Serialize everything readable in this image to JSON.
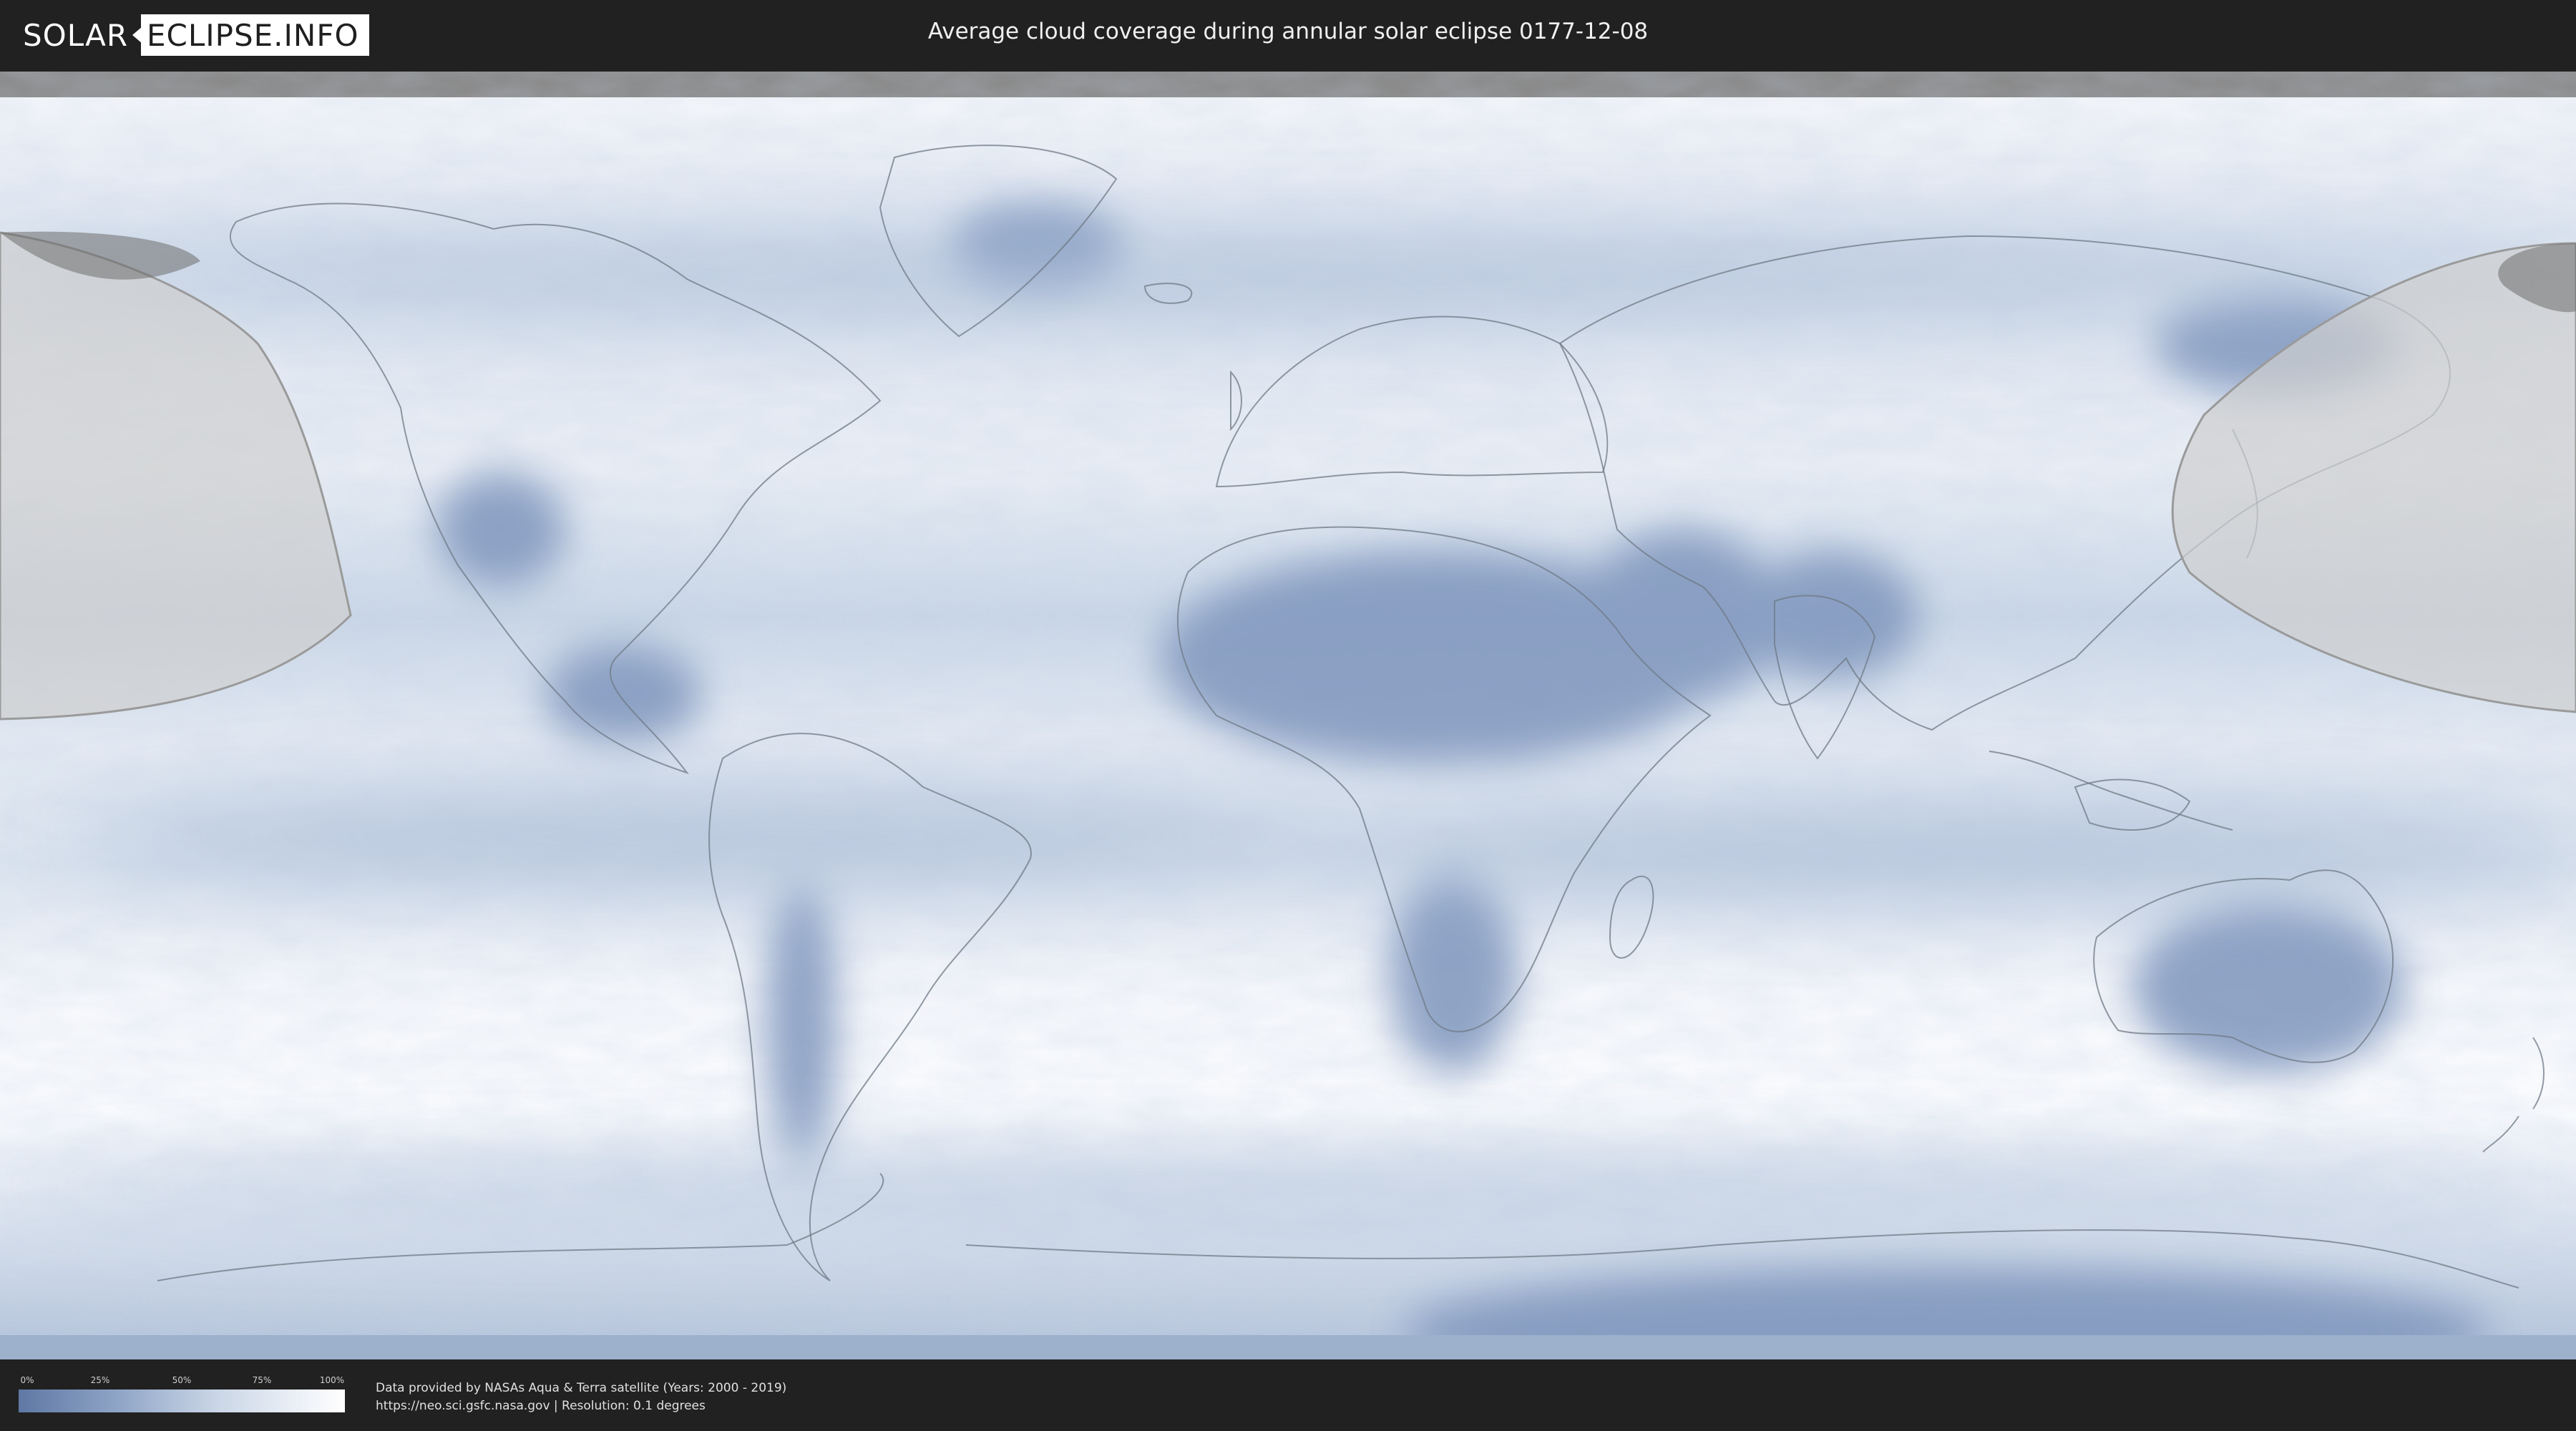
{
  "logo": {
    "part1": "SOLAR",
    "part2": "ECLIPSE.INFO"
  },
  "title": "Average cloud coverage during annular solar eclipse 0177-12-08",
  "legend": {
    "ticks": [
      "0%",
      "25%",
      "50%",
      "75%",
      "100%"
    ],
    "colors": {
      "low": "#5f78a4",
      "high": "#ffffff"
    }
  },
  "attribution": {
    "line1": "Data provided by NASAs Aqua & Terra satellite (Years: 2000 - 2019)",
    "line2": "https://neo.sci.gsfc.nasa.gov | Resolution: 0.1 degrees"
  },
  "map": {
    "projection": "equirectangular",
    "colors": {
      "clear_sky": "#5f78a4",
      "full_cloud": "#ffffff",
      "eclipse_zone": "#cfcfcf",
      "borders": "#6f7a86"
    }
  }
}
